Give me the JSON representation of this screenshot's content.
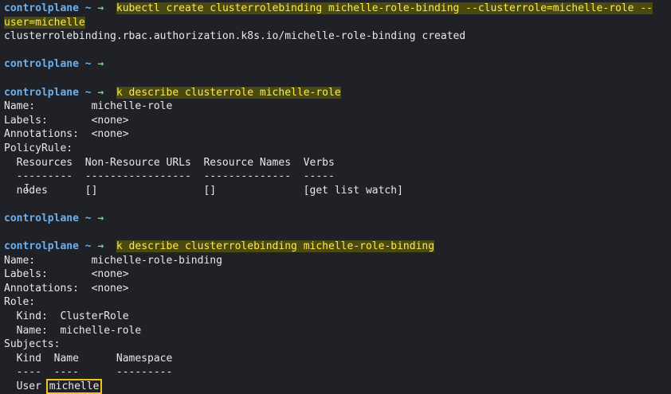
{
  "prompt": "controlplane",
  "arrow": "→",
  "tilde": "~",
  "cmd1_a": "kubectl create clusterrolebinding michelle-role-binding --clusterrole=michelle-role --",
  "cmd1_b": "user=michelle",
  "out1": "clusterrolebinding.rbac.authorization.k8s.io/michelle-role-binding created",
  "cmd2": "k describe clusterrole michelle-role",
  "cr_name": "Name:         michelle-role",
  "cr_labels": "Labels:       <none>",
  "cr_annotations": "Annotations:  <none>",
  "cr_policyrule": "PolicyRule:",
  "cr_header": "  Resources  Non-Resource URLs  Resource Names  Verbs",
  "cr_divider": "  ---------  -----------------  --------------  -----",
  "cr_row": "  nodes      []                 []              [get list watch]",
  "cmd3": "k describe clusterrolebinding michelle-role-binding",
  "crb_name": "Name:         michelle-role-binding",
  "crb_labels": "Labels:       <none>",
  "crb_annotations": "Annotations:  <none>",
  "crb_role": "Role:",
  "crb_kind": "  Kind:  ClusterRole",
  "crb_rolename": "  Name:  michelle-role",
  "crb_subjects": "Subjects:",
  "subj_header": "  Kind  Name      Namespace",
  "subj_divider": "  ----  ----      ---------",
  "subj_kind": "  User ",
  "subj_name": "michelle",
  "cursor_glyph": "I"
}
